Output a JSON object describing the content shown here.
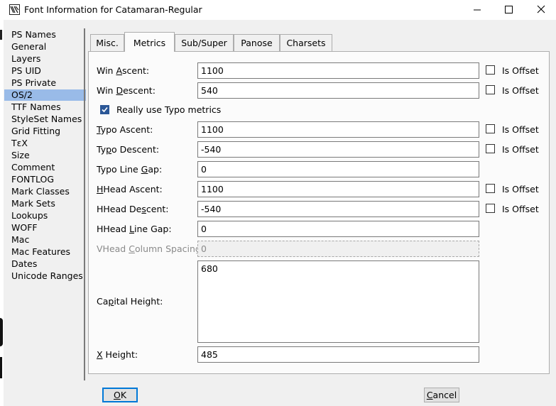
{
  "window": {
    "title": "Font Information for Catamaran-Regular",
    "minimize_label": "Minimize",
    "maximize_label": "Maximize",
    "close_label": "Close"
  },
  "sidebar": {
    "items": [
      {
        "label": "PS Names"
      },
      {
        "label": "General"
      },
      {
        "label": "Layers"
      },
      {
        "label": "PS UID"
      },
      {
        "label": "PS Private"
      },
      {
        "label": "OS/2",
        "selected": true
      },
      {
        "label": "TTF Names"
      },
      {
        "label": "StyleSet Names"
      },
      {
        "label": "Grid Fitting"
      },
      {
        "label": "TεX"
      },
      {
        "label": "Size"
      },
      {
        "label": "Comment"
      },
      {
        "label": "FONTLOG"
      },
      {
        "label": "Mark Classes"
      },
      {
        "label": "Mark Sets"
      },
      {
        "label": "Lookups"
      },
      {
        "label": "WOFF"
      },
      {
        "label": "Mac"
      },
      {
        "label": "Mac Features"
      },
      {
        "label": "Dates"
      },
      {
        "label": "Unicode Ranges"
      }
    ]
  },
  "tabs": [
    {
      "label": "Misc."
    },
    {
      "label": "Metrics",
      "active": true
    },
    {
      "label": "Sub/Super"
    },
    {
      "label": "Panose"
    },
    {
      "label": "Charsets"
    }
  ],
  "metrics": {
    "win_ascent": {
      "pre": "Win ",
      "u": "A",
      "post": "scent:",
      "value": "1100"
    },
    "win_descent": {
      "pre": "Win ",
      "u": "D",
      "post": "escent:",
      "value": "540"
    },
    "really_use_typo": {
      "label": "Really use Typo metrics",
      "checked": true
    },
    "typo_ascent": {
      "pre": "",
      "u": "T",
      "post": "ypo Ascent:",
      "value": "1100"
    },
    "typo_descent": {
      "pre": "Ty",
      "u": "p",
      "post": "o Descent:",
      "value": "-540"
    },
    "typo_line_gap": {
      "pre": "Typo Line ",
      "u": "G",
      "post": "ap:",
      "value": "0"
    },
    "hhead_ascent": {
      "pre": "",
      "u": "H",
      "post": "Head Ascent:",
      "value": "1100"
    },
    "hhead_descent": {
      "pre": "HHead De",
      "u": "s",
      "post": "cent:",
      "value": "-540"
    },
    "hhead_line_gap": {
      "pre": "HHead ",
      "u": "L",
      "post": "ine Gap:",
      "value": "0"
    },
    "vhead_column_spacing": {
      "pre": "VHead ",
      "u": "C",
      "post": "olumn Spacing:",
      "value": "0",
      "disabled": true
    },
    "capital_height": {
      "pre": "Ca",
      "u": "p",
      "post": "ital Height:",
      "value": "680"
    },
    "x_height": {
      "pre": "",
      "u": "X",
      "post": " Height:",
      "value": "485"
    },
    "is_offset_label": "Is Offset"
  },
  "buttons": {
    "ok": {
      "u": "O",
      "post": "K"
    },
    "cancel": {
      "u": "C",
      "post": "ancel"
    }
  },
  "colors": {
    "selection": "#99bbe8",
    "checkbox_checked": "#2b5797",
    "default_button_border": "#0078d7"
  }
}
